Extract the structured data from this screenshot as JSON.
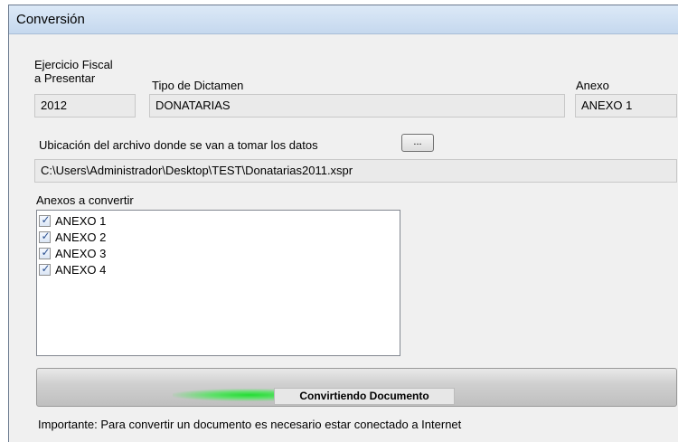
{
  "window": {
    "title": "Conversión"
  },
  "fields": {
    "ejercicio": {
      "label_line1": "Ejercicio Fiscal",
      "label_line2": "a Presentar",
      "value": "2012"
    },
    "tipo": {
      "label": "Tipo de Dictamen",
      "value": "DONATARIAS"
    },
    "anexo": {
      "label": "Anexo",
      "value": "ANEXO 1"
    },
    "ubicacion": {
      "label": "Ubicación del archivo donde se van a tomar los datos",
      "browse_label": "...",
      "value": "C:\\Users\\Administrador\\Desktop\\TEST\\Donatarias2011.xspr"
    }
  },
  "anexos": {
    "label": "Anexos a convertir",
    "items": [
      {
        "label": "ANEXO 1",
        "checked": true
      },
      {
        "label": "ANEXO 2",
        "checked": true
      },
      {
        "label": "ANEXO 3",
        "checked": true
      },
      {
        "label": "ANEXO 4",
        "checked": true
      }
    ],
    "check_glyph": "✓"
  },
  "progress": {
    "text": "Convirtiendo Documento",
    "color": "#22dd33"
  },
  "note": "Importante: Para convertir un documento es necesario estar conectado a Internet"
}
